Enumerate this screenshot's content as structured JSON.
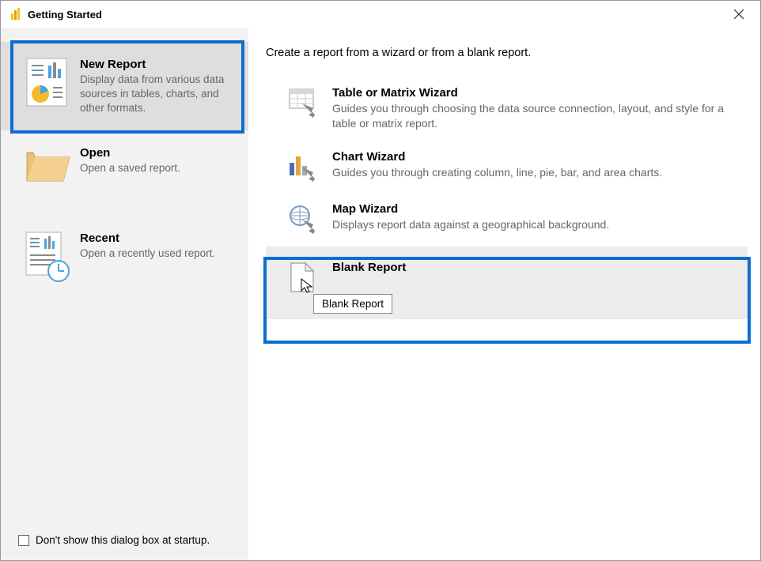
{
  "titlebar": {
    "title": "Getting Started"
  },
  "sidebar": {
    "items": [
      {
        "title": "New Report",
        "desc": "Display data from various data sources in tables, charts, and other formats."
      },
      {
        "title": "Open",
        "desc": "Open a saved report."
      },
      {
        "title": "Recent",
        "desc": "Open a recently used report."
      }
    ]
  },
  "content": {
    "heading": "Create a report from a wizard or from a blank report.",
    "options": [
      {
        "title": "Table or Matrix Wizard",
        "desc": "Guides you through choosing the data source connection, layout, and style for a table or matrix report."
      },
      {
        "title": "Chart Wizard",
        "desc": "Guides you through creating column, line, pie, bar, and area charts."
      },
      {
        "title": "Map Wizard",
        "desc": "Displays report data against a geographical background."
      },
      {
        "title": "Blank Report",
        "desc": ""
      }
    ],
    "tooltip": "Blank Report"
  },
  "footer": {
    "checkbox_label": "Don't show this dialog box at startup."
  }
}
